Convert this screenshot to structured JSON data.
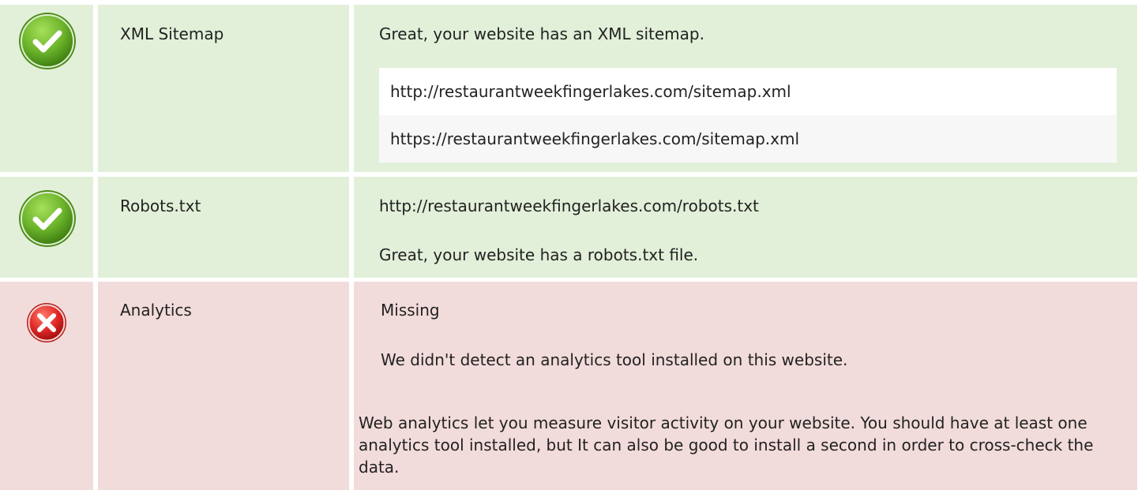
{
  "checks": {
    "sitemap": {
      "status": "pass",
      "label": "XML Sitemap",
      "message": "Great, your website has an XML sitemap.",
      "urls": [
        "http://restaurantweekfingerlakes.com/sitemap.xml",
        "https://restaurantweekfingerlakes.com/sitemap.xml"
      ]
    },
    "robots": {
      "status": "pass",
      "label": "Robots.txt",
      "url": "http://restaurantweekfingerlakes.com/robots.txt",
      "message": "Great, your website has a robots.txt file."
    },
    "analytics": {
      "status": "fail",
      "label": "Analytics",
      "result": "Missing",
      "message": "We didn't detect an analytics tool installed on this website.",
      "description": "Web analytics let you measure visitor activity on your website. You should have at least one analytics tool installed, but It can also be good to install a second in order to cross-check the data."
    }
  },
  "colors": {
    "pass_background": "#e2f0d9",
    "fail_background": "#f2dcdb",
    "pass_icon": "#6ab32a",
    "fail_icon": "#e02828"
  },
  "icons": {
    "pass": "check-circle-icon",
    "fail": "x-circle-icon"
  }
}
